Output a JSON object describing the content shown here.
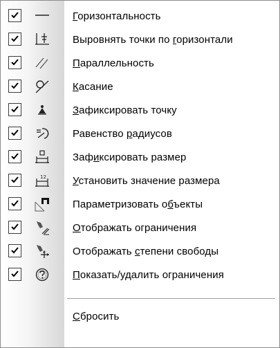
{
  "menu": {
    "items": [
      {
        "key": "horizontal",
        "checked": true,
        "icon": "horizontal-line-icon",
        "pre": "",
        "u": "Г",
        "post": "оризонтальность"
      },
      {
        "key": "align-points-horizontal",
        "checked": true,
        "icon": "align-points-horizontal-icon",
        "pre": "Выровнять точки по ",
        "u": "г",
        "post": "оризонтали"
      },
      {
        "key": "parallel",
        "checked": true,
        "icon": "parallel-lines-icon",
        "pre": "",
        "u": "П",
        "post": "араллельность"
      },
      {
        "key": "tangency",
        "checked": true,
        "icon": "tangency-icon",
        "pre": "",
        "u": "К",
        "post": "асание"
      },
      {
        "key": "fix-point",
        "checked": true,
        "icon": "fix-point-icon",
        "pre": "",
        "u": "З",
        "post": "афиксировать точку"
      },
      {
        "key": "equal-radii",
        "checked": true,
        "icon": "equal-radius-icon",
        "pre": "Равенство ",
        "u": "р",
        "post": "адиусов"
      },
      {
        "key": "fix-dimension",
        "checked": true,
        "icon": "fix-dimension-icon",
        "pre": "Заф",
        "u": "и",
        "post": "ксировать размер"
      },
      {
        "key": "set-dimension-value",
        "checked": true,
        "icon": "set-dimension-value-icon",
        "pre": "",
        "u": "У",
        "post": "становить значение размера"
      },
      {
        "key": "parametrize-objects",
        "checked": true,
        "icon": "parametrize-icon",
        "pre": "Параметризовать о",
        "u": "б",
        "post": "ъекты"
      },
      {
        "key": "show-constraints",
        "checked": true,
        "icon": "show-constraints-icon",
        "pre": "",
        "u": "О",
        "post": "тображать ограничения"
      },
      {
        "key": "show-dof",
        "checked": true,
        "icon": "show-dof-icon",
        "pre": "Отображать ",
        "u": "с",
        "post": "тепени свободы"
      },
      {
        "key": "show-delete-constraints",
        "checked": true,
        "icon": "show-delete-constraints-icon",
        "pre": "",
        "u": "П",
        "post": "оказать/удалить ограничения"
      }
    ],
    "reset": {
      "pre": "",
      "u": "С",
      "post": "бросить"
    }
  }
}
